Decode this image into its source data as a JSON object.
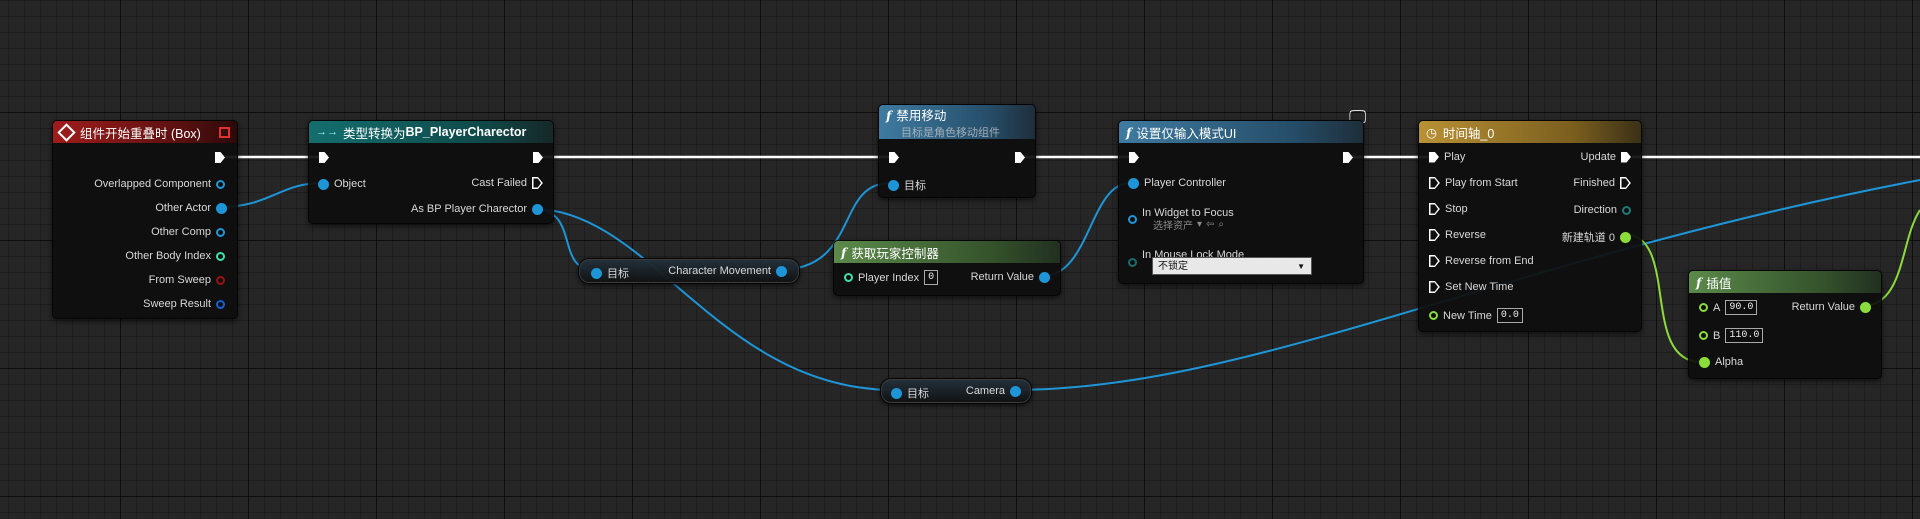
{
  "overlap_node": {
    "title": "组件开始重叠时 (Box)",
    "pins": [
      "Overlapped Component",
      "Other Actor",
      "Other Comp",
      "Other Body Index",
      "From Sweep",
      "Sweep Result"
    ]
  },
  "cast_node": {
    "icon": "→→",
    "title": "类型转换为 ",
    "title_bold": "BP_PlayerCharector",
    "pin_object": "Object",
    "pin_cast_failed": "Cast Failed",
    "pin_as": "As BP Player Charector"
  },
  "char_move_node": {
    "pin_in": "目标",
    "pin_out": "Character Movement"
  },
  "disable_move_node": {
    "title": "禁用移动",
    "subtitle": "目标是角色移动组件",
    "pin_target": "目标"
  },
  "get_pc_node": {
    "title": "获取玩家控制器",
    "pin_index": "Player Index",
    "index_value": "0",
    "pin_return": "Return Value"
  },
  "set_input_node": {
    "title": "设置仅输入模式UI",
    "pin_pc": "Player Controller",
    "pin_widget": "In Widget to Focus",
    "asset_select": "选择资产",
    "pin_lock": "In Mouse Lock Mode",
    "lock_value": "不锁定"
  },
  "camera_node": {
    "pin_in": "目标",
    "pin_out": "Camera"
  },
  "timeline_node": {
    "title": "时间轴_0",
    "inputs": [
      "Play",
      "Play from Start",
      "Stop",
      "Reverse",
      "Reverse from End",
      "Set New Time"
    ],
    "new_time_label": "New Time",
    "new_time_value": "0.0",
    "outputs": [
      "Update",
      "Finished",
      "Direction",
      "新建轨道 0"
    ]
  },
  "lerp_node": {
    "title": "插值",
    "pin_a": "A",
    "a_value": "90.0",
    "pin_b": "B",
    "b_value": "110.0",
    "pin_alpha": "Alpha",
    "pin_return": "Return Value"
  },
  "colors": {
    "exec_wire": "#ffffff",
    "object_wire": "#1e95d6",
    "float_wire": "#8bdc3a",
    "event_header": "#a01c1c",
    "cast_header": "#146e6e",
    "function_header": "#3e7ba0",
    "pure_header": "#5b8a4a",
    "timeline_header": "#b99135"
  },
  "icons": [
    "event-icon",
    "cast-icon",
    "function-icon",
    "timeline-clock-icon",
    "monitor-icon",
    "close-delegate-icon"
  ]
}
